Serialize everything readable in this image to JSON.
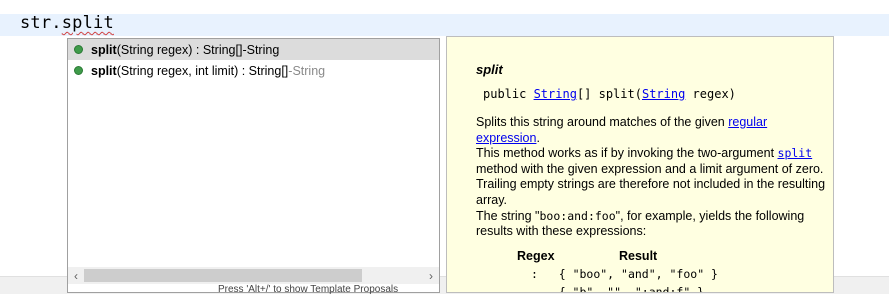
{
  "editor": {
    "prefix": "str.",
    "method": "split"
  },
  "proposals": [
    {
      "name": "split",
      "signature": "(String regex) : String[]",
      "separator": " - ",
      "owner": "String",
      "selected": true
    },
    {
      "name": "split",
      "signature": "(String regex, int limit) : String[]",
      "separator": " - ",
      "owner": "String",
      "selected": false
    }
  ],
  "scrollbar": {
    "left_arrow": "‹",
    "right_arrow": "›"
  },
  "status_peek": "Press 'Alt+/' to show Template Proposals",
  "doc": {
    "title": "split",
    "decl_public": "public ",
    "decl_type": "String",
    "decl_mid": "[] split(",
    "decl_param_type": "String",
    "decl_end": " regex)",
    "p1_text": "Splits this string around matches of the given ",
    "p1_link": "regular expression",
    "p1_end": ".",
    "p2_start": "This method works as if by invoking the two-argument ",
    "p2_link": "split",
    "p2_end": " method with the given expression and a limit argument of zero. Trailing empty strings are therefore not included in the resulting array.",
    "p3_start": "The string \"",
    "p3_code": "boo:and:foo",
    "p3_end": "\", for example, yields the following results with these expressions:",
    "table_header_regex": "Regex",
    "table_header_result": "Result",
    "row1_regex": ":",
    "row1_result": "{ \"boo\", \"and\", \"foo\" }",
    "row2_result": "{ \"b\", \"\", \":and:f\" }"
  }
}
